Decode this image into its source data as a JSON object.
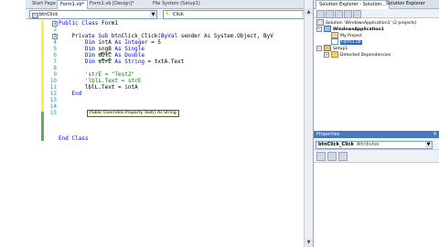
{
  "editor_tabs": [
    {
      "label": "Start Page",
      "active": false
    },
    {
      "label": "Form1.vb*",
      "active": true
    },
    {
      "label": "Form1.vb [Design]*",
      "active": false
    },
    {
      "label": "File System (Setup1)",
      "active": false
    }
  ],
  "editor_tab_close": "×",
  "dropdowns": {
    "object_value": "btnClick",
    "event_value": "Click"
  },
  "code_lines": [
    {
      "num": "1",
      "kw1": "Public Class ",
      "text": "Form1"
    },
    {
      "num": "2",
      "text": ""
    },
    {
      "num": "3",
      "indent": "    ",
      "kw1": "Private Sub ",
      "text": "btnClick_Click(",
      "kw2": "ByVal ",
      "text2": "sender ",
      "kw3": "As ",
      "text3": "System.Object, ByV"
    },
    {
      "num": "4",
      "indent": "        ",
      "kw1": "Dim ",
      "text": "intA ",
      "kw2": "As Integer ",
      "text2": "= 5"
    },
    {
      "num": "5",
      "indent": "        ",
      "kw1": "Dim ",
      "text": "sngB",
      "kw2": " As Single",
      "text2": ""
    },
    {
      "num": "6",
      "indent": "        ",
      "kw1": "Dim ",
      "text": "dblC",
      "kw2": " As Double",
      "text2": ""
    },
    {
      "num": "7",
      "indent": "        ",
      "kw1": "Dim ",
      "text": "strE ",
      "kw2": "As String ",
      "text2": "= txtA.Text"
    },
    {
      "num": "8",
      "text": ""
    },
    {
      "num": "9",
      "indent": "        ",
      "comment": "'strE = \"Test2\""
    },
    {
      "num": "10",
      "indent": "        ",
      "comment": "'lblL.Text = strE"
    },
    {
      "num": "11",
      "indent": "        ",
      "text": "lblL.Text = intA"
    },
    {
      "num": "12",
      "indent": "    ",
      "kw1": "End ",
      "text": ""
    },
    {
      "num": "13",
      "text": ""
    },
    {
      "num": "14",
      "text": ""
    },
    {
      "num": "15",
      "kw1": "End Class",
      "text": ""
    }
  ],
  "tooltip": "Public Overrides Property Text() As String",
  "scrollbar": {
    "up": "▲",
    "down": "▼"
  },
  "solution_explorer": {
    "tabs": [
      {
        "label": "Solution Explorer - Solution...",
        "active": true
      },
      {
        "label": "Solution Explorer",
        "active": false
      }
    ],
    "nodes": [
      {
        "label": "Solution 'WindowsApplication1' (2 projects)",
        "toggle": "",
        "selected": false,
        "bold": false
      },
      {
        "label": "WindowsApplication1",
        "toggle": "−",
        "selected": false,
        "bold": true
      },
      {
        "label": "My Project",
        "toggle": "",
        "selected": false,
        "bold": false
      },
      {
        "label": "Form1.vb",
        "toggle": "",
        "selected": true,
        "bold": false
      },
      {
        "label": "Setup1",
        "toggle": "−",
        "selected": false,
        "bold": false
      },
      {
        "label": "Detected Dependencies",
        "toggle": "+",
        "selected": false,
        "bold": false
      }
    ]
  },
  "properties": {
    "title": "Properties",
    "close": "×",
    "object": "btnClick_Click",
    "object_type": "Attributes"
  },
  "colors": {
    "keyword": "#0000ff",
    "comment": "#008000",
    "line_number": "#2b91af",
    "selection": "#316ac5",
    "properties_header": "#4a78c0"
  }
}
